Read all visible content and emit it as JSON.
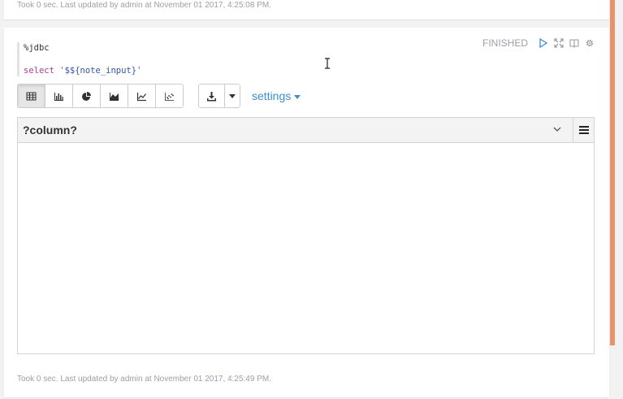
{
  "top_card": {
    "footer": "Took 0 sec. Last updated by admin at November 01 2017, 4:25:08 PM."
  },
  "paragraph": {
    "code_line1": "%jdbc",
    "code_line2_prefix": "select '",
    "code_line2_var": "$${note_input}",
    "code_line2_suffix": "'",
    "status": "FINISHED",
    "footer": "Took 0 sec. Last updated by admin at November 01 2017, 4:25:49 PM."
  },
  "toolbar": {
    "viz_buttons": [
      {
        "icon": "table-icon",
        "active": true
      },
      {
        "icon": "bar-chart-icon",
        "active": false
      },
      {
        "icon": "pie-chart-icon",
        "active": false
      },
      {
        "icon": "area-chart-icon",
        "active": false
      },
      {
        "icon": "line-chart-icon",
        "active": false
      },
      {
        "icon": "scatter-chart-icon",
        "active": false
      }
    ],
    "download_icon": "download-icon",
    "settings_label": "settings"
  },
  "grid": {
    "column_header": "?column?"
  },
  "colors": {
    "accent": "#3b8fd0",
    "scroll_accent": "#e9936b"
  }
}
